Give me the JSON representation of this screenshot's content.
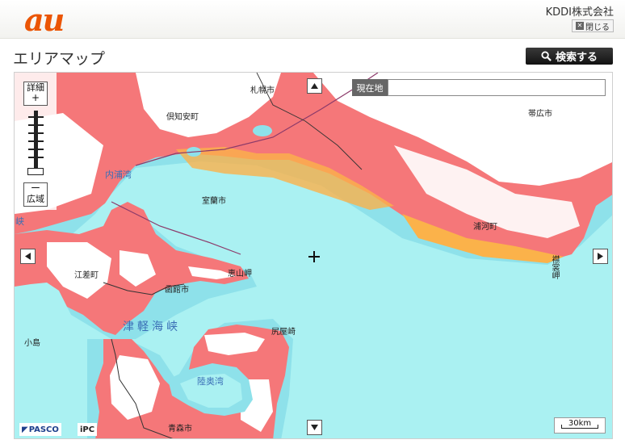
{
  "header": {
    "logo": "au",
    "company": "KDDI株式会社",
    "close_label": "閉じる",
    "close_icon": "close-x-icon"
  },
  "page": {
    "title": "エリアマップ",
    "search_label": "検索する",
    "search_icon": "magnifier-icon"
  },
  "map": {
    "zoom_in_label": "詳細",
    "zoom_in_symbol": "+",
    "zoom_out_symbol": "ー",
    "zoom_out_label": "広域",
    "current_location_label": "現在地",
    "current_location_value": "",
    "places": {
      "sapporo": "札幌市",
      "kutchan": "倶知安町",
      "obihiro": "帯広市",
      "muroran": "室蘭市",
      "urakawa": "浦河町",
      "esashi": "江差町",
      "hakodate": "函館市",
      "esan": "恵山岬",
      "kojima": "小島",
      "shiriya": "尻屋崎",
      "aomori": "青森市",
      "erimo": "襟裳岬"
    },
    "waters": {
      "uchiura": "内浦湾",
      "tsugaru": "津軽海峡",
      "mutsu": "陸奥湾",
      "kyo": "峡"
    },
    "credits": {
      "pasco": "PASCO",
      "ipc": "iPC"
    },
    "scale_label": "30km",
    "colors": {
      "sea": "#aaf1f2",
      "coverage_strong": "#f57779",
      "coverage_edge": "#fbb24a",
      "no_coverage_land": "#ffffff",
      "accent": "#eb5505"
    }
  }
}
